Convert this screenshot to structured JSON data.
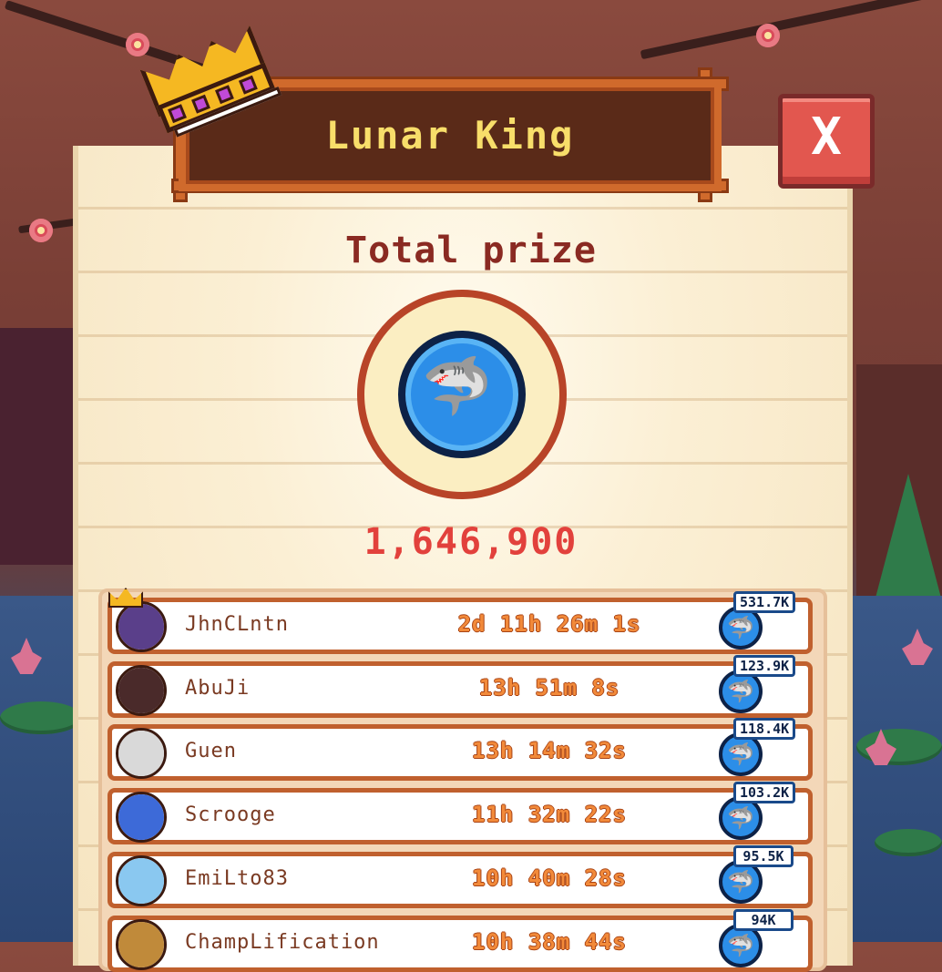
{
  "header": {
    "title": "Lunar King"
  },
  "close_button": {
    "label": "X"
  },
  "prize": {
    "label": "Total prize",
    "amount": "1,646,900"
  },
  "leaderboard": [
    {
      "name": "JhnCLntn",
      "time": "2d 11h 26m 1s",
      "reward": "531.7K",
      "avatar_color": "#5a3f8a",
      "crowned": true
    },
    {
      "name": "AbuJi",
      "time": "13h 51m 8s",
      "reward": "123.9K",
      "avatar_color": "#4a2a2a",
      "crowned": false
    },
    {
      "name": "Guen",
      "time": "13h 14m 32s",
      "reward": "118.4K",
      "avatar_color": "#d9d9d9",
      "crowned": false
    },
    {
      "name": "Scrooge",
      "time": "11h 32m 22s",
      "reward": "103.2K",
      "avatar_color": "#3d6ad8",
      "crowned": false
    },
    {
      "name": "EmiLto83",
      "time": "10h 40m 28s",
      "reward": "95.5K",
      "avatar_color": "#8ac8f0",
      "crowned": false
    },
    {
      "name": "ChampLification",
      "time": "10h 38m 44s",
      "reward": "94K",
      "avatar_color": "#c08a3a",
      "crowned": false
    }
  ],
  "colors": {
    "accent": "#e2413c",
    "coin": "#2c8ee8",
    "title_text": "#f8de6a"
  }
}
